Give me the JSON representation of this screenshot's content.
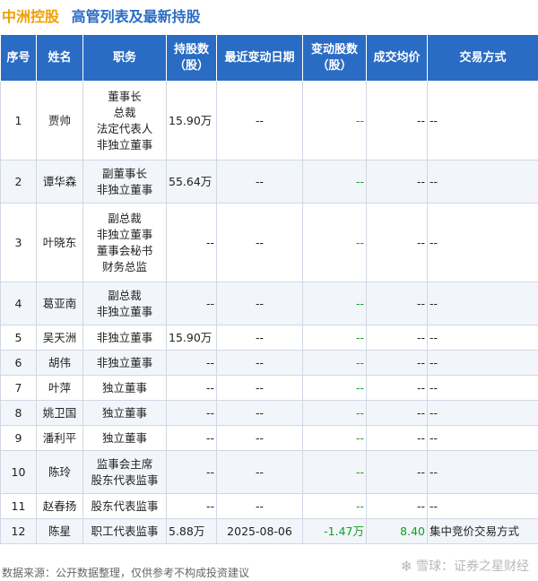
{
  "header": {
    "company": "中洲控股",
    "subject": "高管列表及最新持股"
  },
  "table": {
    "columns": [
      "序号",
      "姓名",
      "职务",
      "持股数（股）",
      "最近变动日期",
      "变动股数（股）",
      "成交均价",
      "交易方式"
    ],
    "rows": [
      {
        "no": "1",
        "name": "贾帅",
        "roles": [
          "董事长",
          "总裁",
          "法定代表人",
          "非独立董事"
        ],
        "shares": "15.90万",
        "date": "--",
        "change": "--",
        "price": "--",
        "method": "--"
      },
      {
        "no": "2",
        "name": "谭华森",
        "roles": [
          "副董事长",
          "非独立董事"
        ],
        "shares": "55.64万",
        "date": "--",
        "change": "--",
        "price": "--",
        "method": "--"
      },
      {
        "no": "3",
        "name": "叶晓东",
        "roles": [
          "副总裁",
          "非独立董事",
          "董事会秘书",
          "财务总监"
        ],
        "shares": "--",
        "date": "--",
        "change": "--",
        "price": "--",
        "method": "--"
      },
      {
        "no": "4",
        "name": "葛亚南",
        "roles": [
          "副总裁",
          "非独立董事"
        ],
        "shares": "--",
        "date": "--",
        "change": "--",
        "price": "--",
        "method": "--"
      },
      {
        "no": "5",
        "name": "吴天洲",
        "roles": [
          "非独立董事"
        ],
        "shares": "15.90万",
        "date": "--",
        "change": "--",
        "price": "--",
        "method": "--"
      },
      {
        "no": "6",
        "name": "胡伟",
        "roles": [
          "非独立董事"
        ],
        "shares": "--",
        "date": "--",
        "change": "--",
        "price": "--",
        "method": "--"
      },
      {
        "no": "7",
        "name": "叶萍",
        "roles": [
          "独立董事"
        ],
        "shares": "--",
        "date": "--",
        "change": "--",
        "price": "--",
        "method": "--"
      },
      {
        "no": "8",
        "name": "姚卫国",
        "roles": [
          "独立董事"
        ],
        "shares": "--",
        "date": "--",
        "change": "--",
        "price": "--",
        "method": "--"
      },
      {
        "no": "9",
        "name": "潘利平",
        "roles": [
          "独立董事"
        ],
        "shares": "--",
        "date": "--",
        "change": "--",
        "price": "--",
        "method": "--"
      },
      {
        "no": "10",
        "name": "陈玲",
        "roles": [
          "监事会主席",
          "股东代表监事"
        ],
        "shares": "--",
        "date": "--",
        "change": "--",
        "price": "--",
        "method": "--"
      },
      {
        "no": "11",
        "name": "赵春扬",
        "roles": [
          "股东代表监事"
        ],
        "shares": "--",
        "date": "--",
        "change": "--",
        "price": "--",
        "method": "--"
      },
      {
        "no": "12",
        "name": "陈星",
        "roles": [
          "职工代表监事"
        ],
        "shares": "5.88万",
        "date": "2025-08-06",
        "change": "-1.47万",
        "price": "8.40",
        "method": "集中竞价交易方式"
      }
    ]
  },
  "footer": {
    "source": "数据来源：公开数据整理，仅供参考不构成投资建议"
  },
  "brand": {
    "text": "雪球：证券之星财经"
  },
  "colors": {
    "header_bg": "#2a6cc4",
    "company": "#f0a000",
    "negative": "#10a020",
    "price": "#10a020"
  }
}
